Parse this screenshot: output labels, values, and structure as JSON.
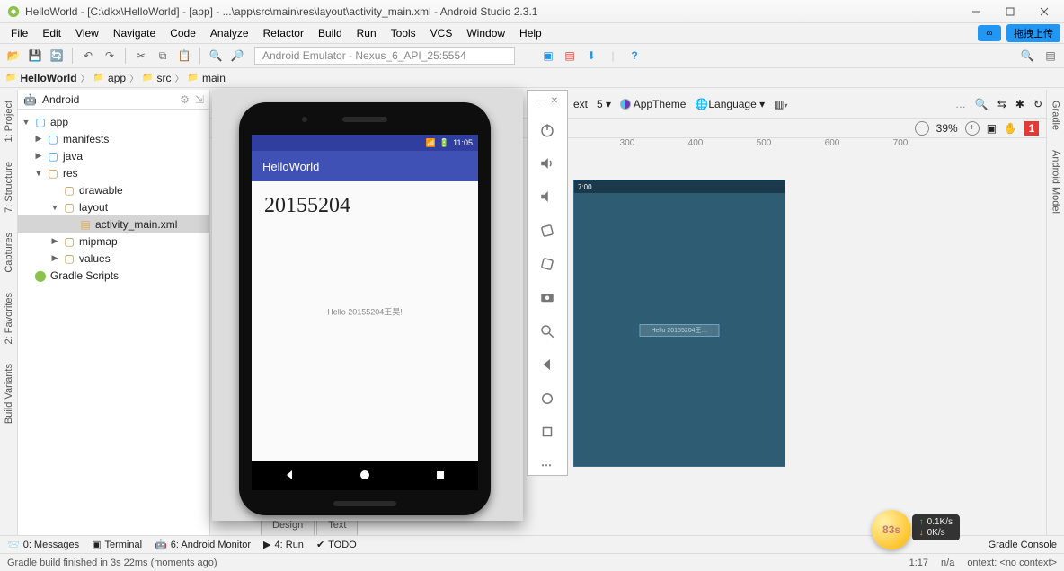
{
  "window": {
    "title": "HelloWorld - [C:\\dkx\\HelloWorld] - [app] - ...\\app\\src\\main\\res\\layout\\activity_main.xml - Android Studio 2.3.1"
  },
  "menu": {
    "items": [
      "File",
      "Edit",
      "View",
      "Navigate",
      "Code",
      "Analyze",
      "Refactor",
      "Build",
      "Run",
      "Tools",
      "VCS",
      "Window",
      "Help"
    ]
  },
  "upload_pill": "拖拽上传",
  "emulator_title": "Android Emulator - Nexus_6_API_25:5554",
  "breadcrumb": {
    "items": [
      "HelloWorld",
      "app",
      "src",
      "main"
    ]
  },
  "left_tabs": [
    "1: Project",
    "7: Structure",
    "Captures",
    "2: Favorites",
    "Build Variants"
  ],
  "right_tabs": [
    "Gradle",
    "Android Model"
  ],
  "tree": {
    "mode": "Android",
    "nodes": [
      {
        "indent": 0,
        "arrow": "▼",
        "ico": "folder-blue",
        "label": "app"
      },
      {
        "indent": 1,
        "arrow": "▶",
        "ico": "folder-blue",
        "label": "manifests"
      },
      {
        "indent": 1,
        "arrow": "▶",
        "ico": "folder-blue",
        "label": "java"
      },
      {
        "indent": 1,
        "arrow": "▼",
        "ico": "folder-or",
        "label": "res"
      },
      {
        "indent": 2,
        "arrow": "",
        "ico": "folder-or",
        "label": "drawable"
      },
      {
        "indent": 2,
        "arrow": "▼",
        "ico": "folder-or",
        "label": "layout"
      },
      {
        "indent": 3,
        "arrow": "",
        "ico": "file-or",
        "label": "activity_main.xml",
        "sel": true
      },
      {
        "indent": 2,
        "arrow": "▶",
        "ico": "folder-or",
        "label": "mipmap"
      },
      {
        "indent": 2,
        "arrow": "▶",
        "ico": "folder-or",
        "label": "values"
      },
      {
        "indent": 0,
        "arrow": "",
        "ico": "android-green",
        "label": "Gradle Scripts"
      }
    ]
  },
  "design": {
    "ext_label": "ext",
    "api_suffix": "5 ▾",
    "theme_label": "AppTheme",
    "lang_label": "Language ▾",
    "zoom": "39%",
    "ruler": [
      "300",
      "400",
      "500",
      "600",
      "700"
    ],
    "canvas_time": "7:00",
    "canvas_label": "Hello 20155204王…",
    "warn": "1"
  },
  "phone": {
    "status_time": "11:05",
    "app_title": "HelloWorld",
    "big_text": "20155204",
    "hello": "Hello 20155204王昊!"
  },
  "editor_tabs": [
    "Design",
    "Text"
  ],
  "bottom": {
    "messages": "0: Messages",
    "terminal": "Terminal",
    "monitor": "6: Android Monitor",
    "run": "4: Run",
    "todo": "TODO",
    "gradle_console": "Gradle Console"
  },
  "status": {
    "msg": "Gradle build finished in 3s 22ms (moments ago)",
    "pos": "1:17",
    "na": "n/a",
    "context": "ontext: <no context>"
  },
  "net": {
    "up": "0.1K/s",
    "down": "0K/s"
  },
  "emoji": "83s"
}
